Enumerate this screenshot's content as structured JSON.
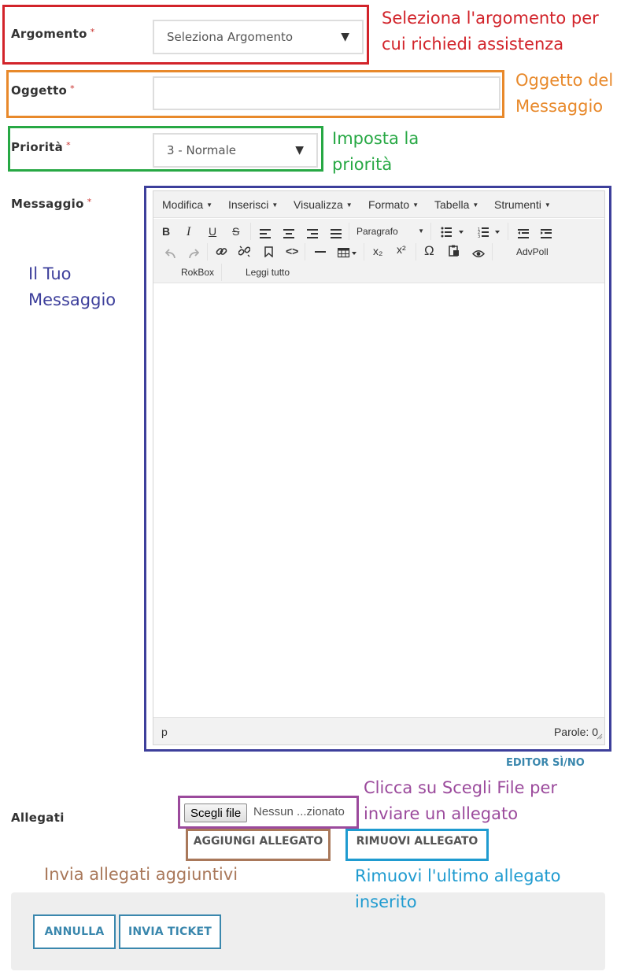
{
  "form": {
    "argomento_label": "Argomento",
    "argomento_value": "Seleziona Argomento",
    "oggetto_label": "Oggetto",
    "oggetto_value": "",
    "priorita_label": "Priorità",
    "priorita_value": "3 - Normale",
    "messaggio_label": "Messaggio",
    "allegati_label": "Allegati",
    "required_mark": "*"
  },
  "editor": {
    "menus": [
      "Modifica",
      "Inserisci",
      "Visualizza",
      "Formato",
      "Tabella",
      "Strumenti"
    ],
    "format_select": "Paragrafo",
    "advpoll": "AdvPoll",
    "rokbox": "RokBox",
    "leggi_tutto": "Leggi tutto",
    "status_path": "p",
    "word_count": "Parole: 0",
    "toggle": "EDITOR SÌ/NO",
    "tools": {
      "bold": "B",
      "italic": "I",
      "underline": "U",
      "strike": "S",
      "subscript": "x₂",
      "superscript": "x²",
      "omega": "Ω"
    }
  },
  "attachments": {
    "choose_file": "Scegli file",
    "no_file": "Nessun ...zionato",
    "add": "AGGIUNGI ALLEGATO",
    "remove": "RIMUOVI ALLEGATO"
  },
  "actions": {
    "cancel": "ANNULLA",
    "submit": "INVIA TICKET"
  },
  "annotations": {
    "argomento_1": "Seleziona l'argomento per",
    "argomento_2": "cui richiedi assistenza",
    "oggetto_1": "Oggetto del",
    "oggetto_2": "Messaggio",
    "priorita_1": "Imposta la",
    "priorita_2": "priorità",
    "messaggio_1": "Il Tuo",
    "messaggio_2": "Messaggio",
    "file_1": "Clicca su Scegli File per",
    "file_2": "inviare un allegato",
    "add_1": "Invia allegati aggiuntivi",
    "remove_1": "Rimuovi l'ultimo allegato",
    "remove_2": "inserito"
  },
  "colors": {
    "red": "#d2232a",
    "orange": "#e8892b",
    "green": "#27a844",
    "navy": "#3d3f9b",
    "purple": "#9b4a9c",
    "brown": "#a9785a",
    "cyan": "#1f9bd0",
    "button_blue": "#3a87ad"
  }
}
